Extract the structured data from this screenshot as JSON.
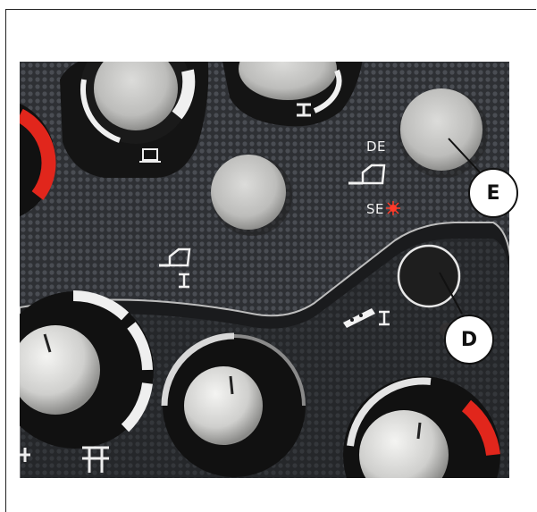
{
  "callouts": {
    "e": "E",
    "d": "D"
  },
  "panel_labels": {
    "de": "DE",
    "se": "SE"
  },
  "icons": [
    "seat-recline-icon",
    "monitor-icon",
    "header-icon",
    "header-icon",
    "header-icon",
    "feeder-icon"
  ],
  "colors": {
    "panel": "#2b2d31",
    "mesh": "#3a3d42",
    "button_grey": "#c9c9c7",
    "accent_red": "#e1261c",
    "indicator_red": "#ff3b2a"
  }
}
